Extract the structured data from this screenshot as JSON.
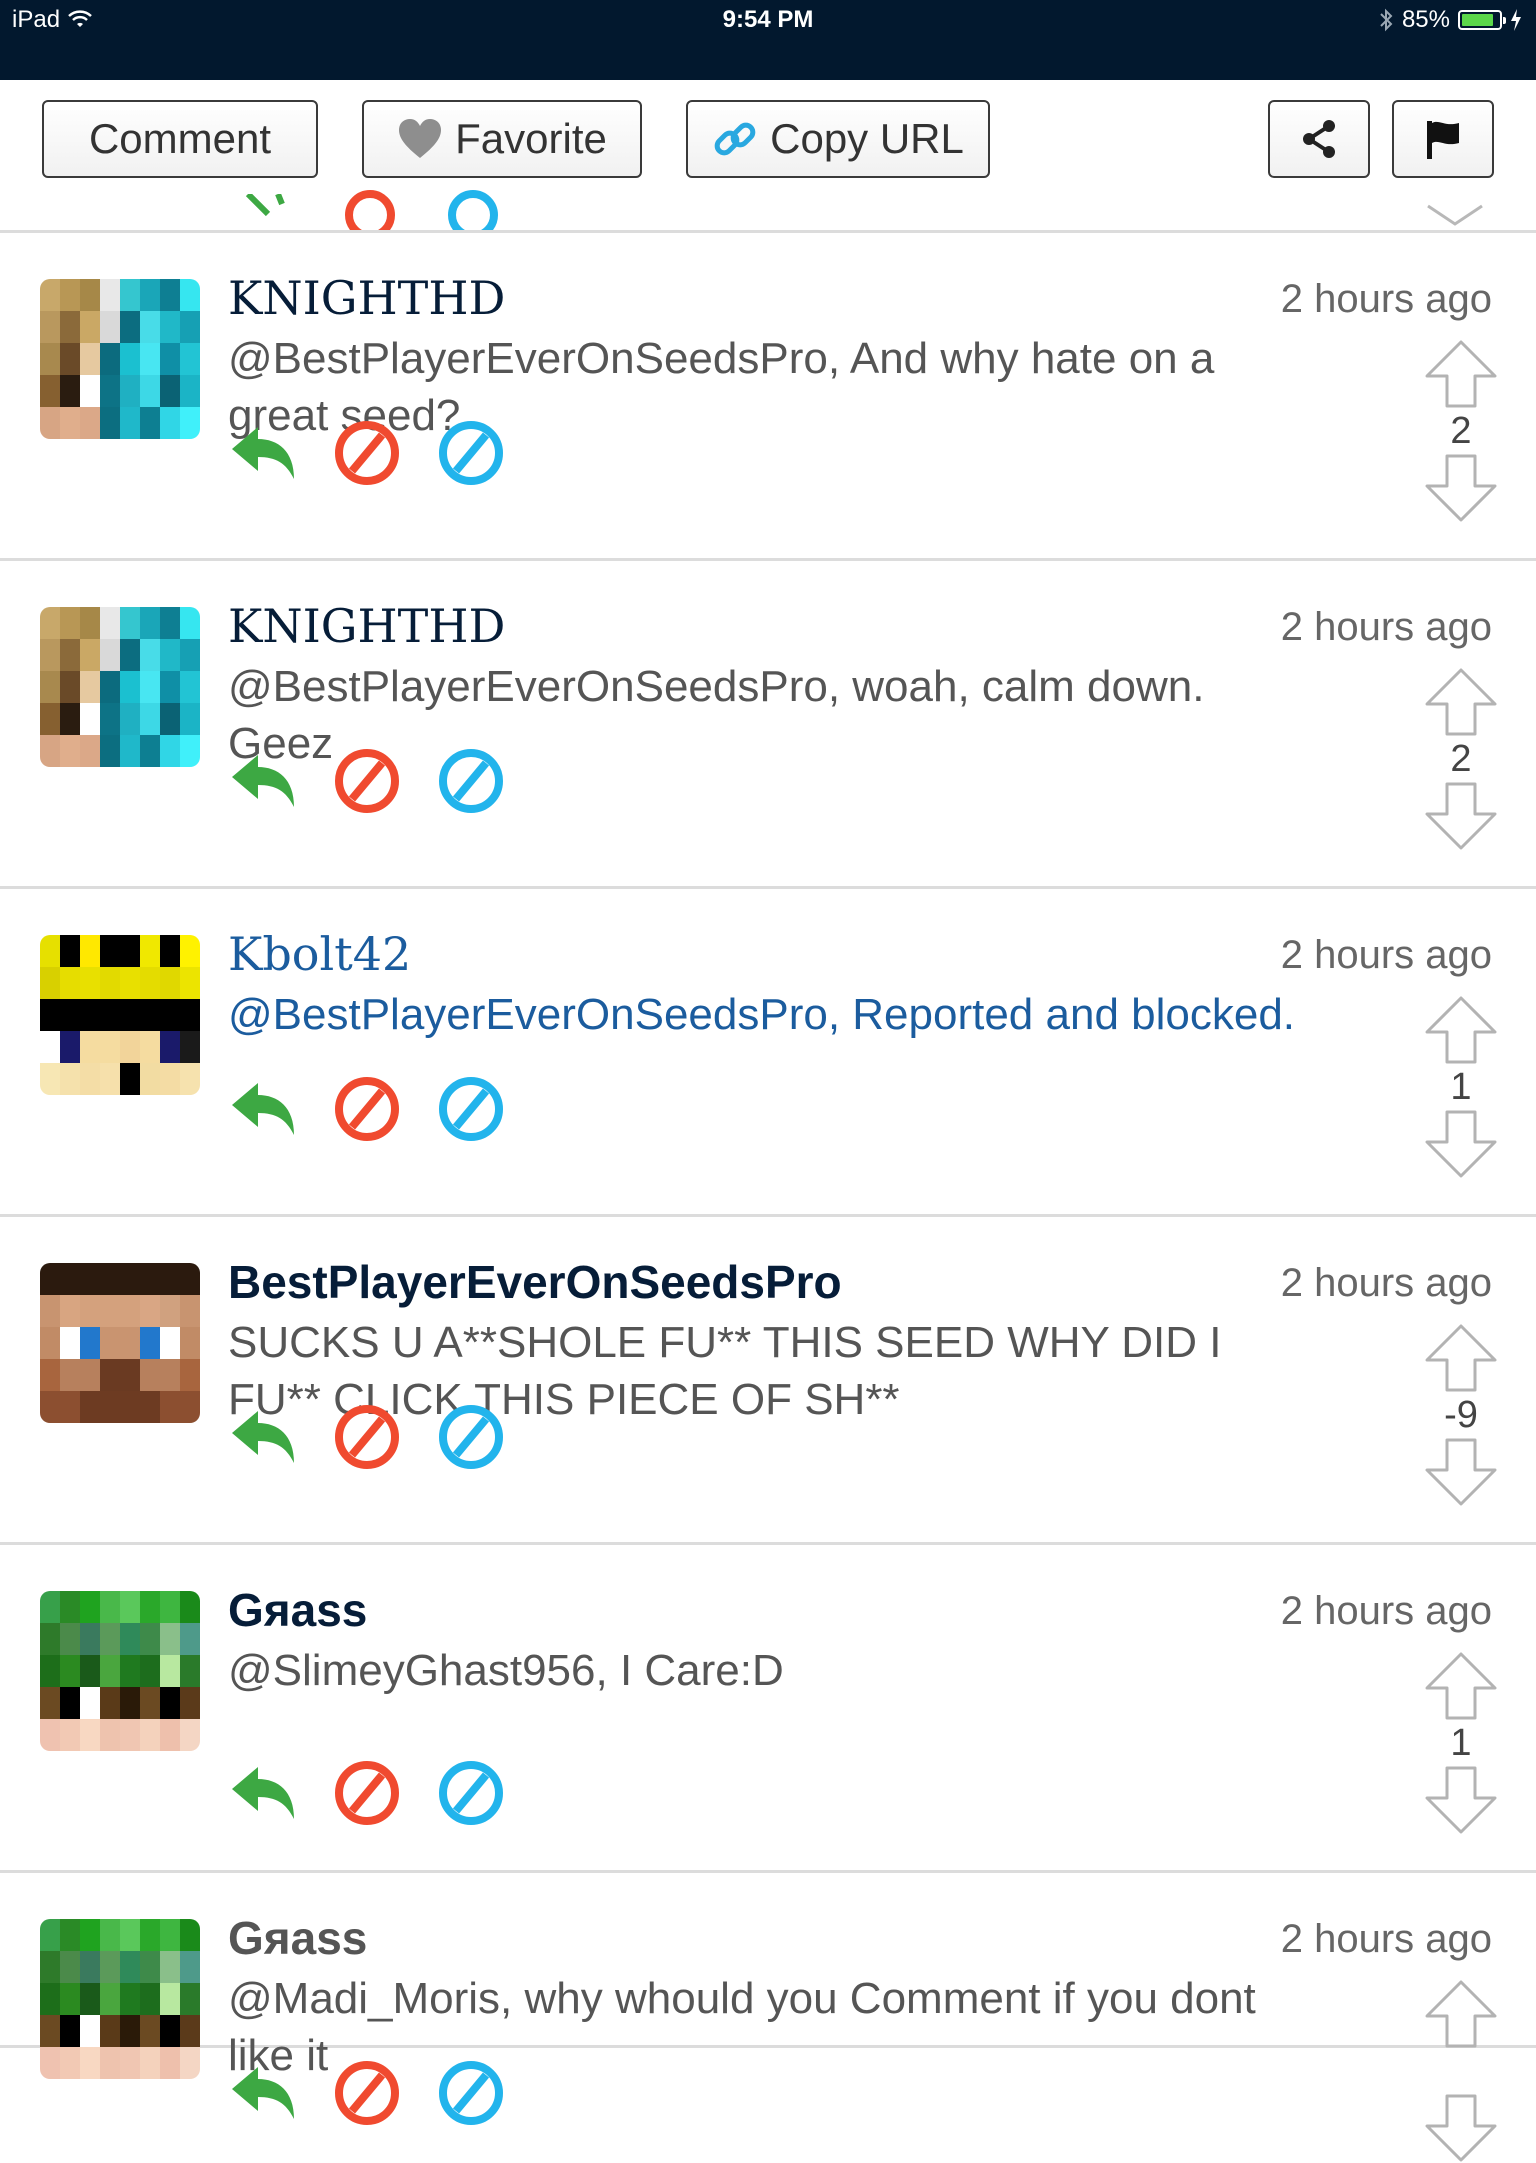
{
  "status_bar": {
    "device": "iPad",
    "time": "9:54 PM",
    "battery": "85%",
    "battery_level": 0.85
  },
  "toolbar": {
    "comment_label": "Comment",
    "favorite_label": "Favorite",
    "copy_url_label": "Copy URL"
  },
  "colors": {
    "reply_green": "#3da843",
    "report_red": "#f04a2f",
    "block_blue": "#22b4ec",
    "status_bg": "#02182e",
    "link_blue": "#1b5c9e"
  },
  "comments": [
    {
      "username": "KNIGHTHD",
      "time": "2 hours ago",
      "text": "@BestPlayerEverOnSeedsPro, And why hate on a great seed?",
      "votes": "2"
    },
    {
      "username": "KNIGHTHD",
      "time": "2 hours ago",
      "text": "@BestPlayerEverOnSeedsPro, woah, calm down. Geez",
      "votes": "2"
    },
    {
      "username": "Kbolt42",
      "time": "2 hours ago",
      "text": "@BestPlayerEverOnSeedsPro, Reported and blocked.",
      "votes": "1"
    },
    {
      "username": "BestPlayerEverOnSeedsPro",
      "time": "2 hours ago",
      "text": "SUCKS U A**SHOLE FU** THIS SEED WHY DID I FU** CLICK THIS PIECE OF SH**",
      "votes": "-9"
    },
    {
      "username": "Gяass",
      "time": "2 hours ago",
      "text": "@SlimeyGhast956, I Care:D",
      "votes": "1"
    },
    {
      "username": "Gяass",
      "time": "2 hours ago",
      "text": "@Madi_Moris, why whould you Comment if you dont like it",
      "votes": ""
    }
  ]
}
